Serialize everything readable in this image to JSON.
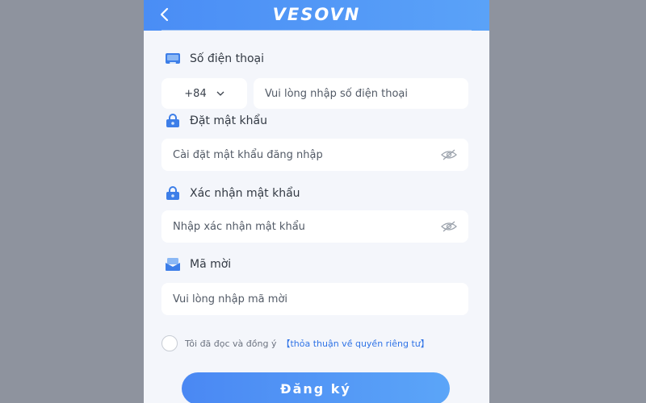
{
  "header": {
    "back_icon": "chevron-left-icon",
    "brand": "VESOVN"
  },
  "phone_section": {
    "label": "Số điện thoại",
    "country_code": "+84",
    "placeholder": "Vui lòng nhập số điện thoại"
  },
  "password_section": {
    "label": "Đặt mật khẩu",
    "placeholder": "Cài đặt mật khẩu đăng nhập"
  },
  "confirm_section": {
    "label": "Xác nhận mật khẩu",
    "placeholder": "Nhập xác nhận mật khẩu"
  },
  "invite_section": {
    "label": "Mã mời",
    "placeholder": "Vui lòng nhập mã mời"
  },
  "agreement": {
    "text": "Tôi đã đọc và đồng ý",
    "link": "【thỏa thuận về quyền riêng tư】"
  },
  "submit_label": "Đăng ký",
  "colors": {
    "primary": "#4a8df5",
    "link": "#2f73e6",
    "page_bg": "#8e939e",
    "form_bg": "#f4f6fb"
  }
}
